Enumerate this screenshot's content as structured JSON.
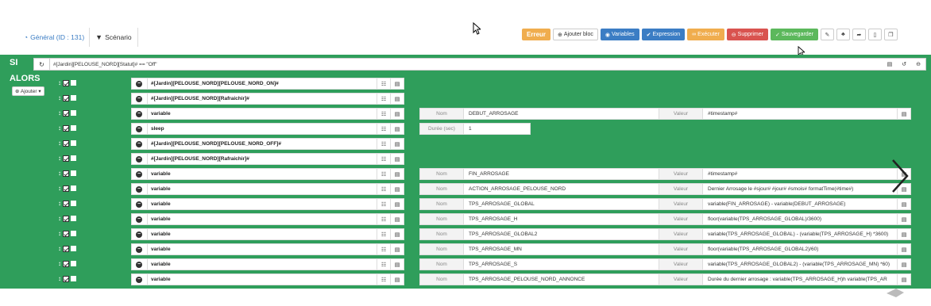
{
  "tabs": {
    "general": "Général (ID : 131)",
    "scenario": "Scénario"
  },
  "toolbar": {
    "error": "Erreur",
    "add_block": "Ajouter bloc",
    "variables": "Variables",
    "expression": "Expression",
    "execute": "Exécuter",
    "delete": "Supprimer",
    "save": "Sauvegarder"
  },
  "block": {
    "si": "SI",
    "alors": "ALORS",
    "ajouter": "Ajouter",
    "condition": "#[Jardin][PELOUSE_NORD][Statut]# == \"Off\""
  },
  "labels": {
    "nom": "Nom",
    "valeur": "Valeur",
    "duree": "Durée (sec)"
  },
  "rows": [
    {
      "name": "#[Jardin][PELOUSE_NORD][PELOUSE_NORD_ON]#"
    },
    {
      "name": "#[Jardin][PELOUSE_NORD][Rafraichir]#"
    },
    {
      "name": "variable",
      "nom": "DEBUT_ARROSAGE",
      "valeur": "#timestamp#"
    },
    {
      "name": "sleep",
      "duree": "1"
    },
    {
      "name": "#[Jardin][PELOUSE_NORD][PELOUSE_NORD_OFF]#"
    },
    {
      "name": "#[Jardin][PELOUSE_NORD][Rafraichir]#"
    },
    {
      "name": "variable",
      "nom": "FIN_ARROSAGE",
      "valeur": "#timestamp#"
    },
    {
      "name": "variable",
      "nom": "ACTION_ARROSAGE_PELOUSE_NORD",
      "valeur": "Dernier Arrosage le #sjour# #jour# #smois# formatTime(#time#)"
    },
    {
      "name": "variable",
      "nom": "TPS_ARROSAGE_GLOBAL",
      "valeur": "variable(FIN_ARROSAGE) - variable(DEBUT_ARROSAGE)"
    },
    {
      "name": "variable",
      "nom": "TPS_ARROSAGE_H",
      "valeur": "floor(variable(TPS_ARROSAGE_GLOBAL)/3600)"
    },
    {
      "name": "variable",
      "nom": "TPS_ARROSAGE_GLOBAL2",
      "valeur": "variable(TPS_ARROSAGE_GLOBAL) - (variable(TPS_ARROSAGE_H) *3600)"
    },
    {
      "name": "variable",
      "nom": "TPS_ARROSAGE_MN",
      "valeur": "floor(variable(TPS_ARROSAGE_GLOBAL2)/60)"
    },
    {
      "name": "variable",
      "nom": "TPS_ARROSAGE_S",
      "valeur": "variable(TPS_ARROSAGE_GLOBAL2) - (variable(TPS_ARROSAGE_MN) *60)"
    },
    {
      "name": "variable",
      "nom": "TPS_ARROSAGE_PELOUSE_NORD_ANNONCE",
      "valeur": "Durée du dernier arrosage : variable(TPS_ARROSAGE_H)h variable(TPS_AR"
    }
  ]
}
